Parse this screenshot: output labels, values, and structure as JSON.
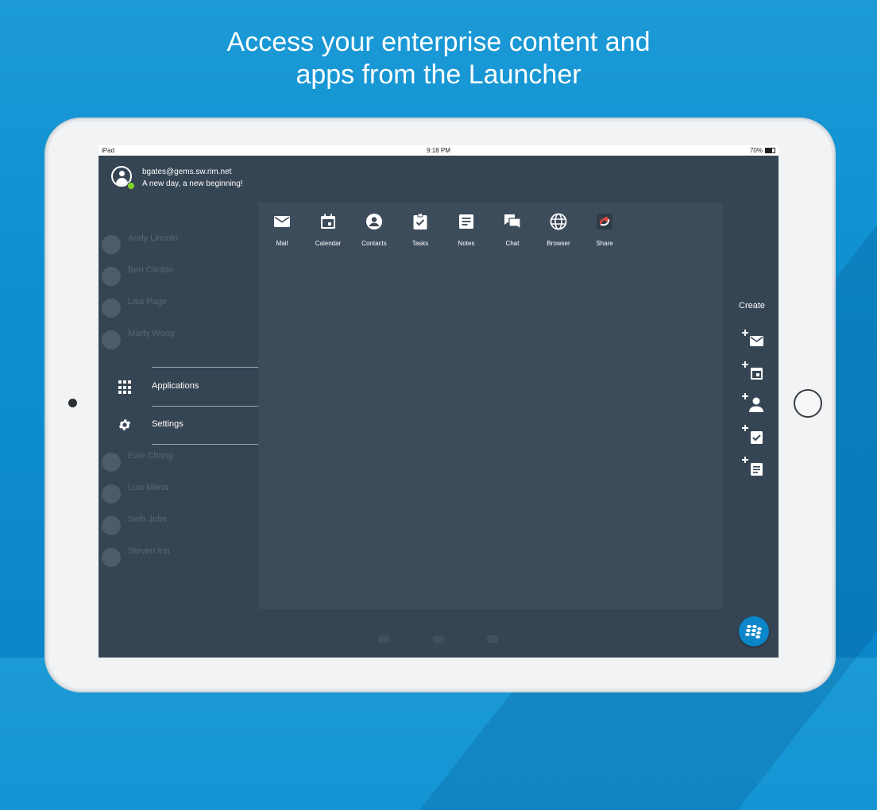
{
  "headline": [
    "Access your enterprise content and",
    "apps from the Launcher"
  ],
  "status_bar": {
    "device": "iPad",
    "time": "9:18 PM",
    "battery": "70%",
    "battery_fill": 0.7
  },
  "profile": {
    "email": "bgates@gems.sw.rim.net",
    "tagline": "A new day, a new beginning!",
    "presence_color": "#7ed321"
  },
  "nav": [
    {
      "label": "Applications",
      "icon": "grid-icon"
    },
    {
      "label": "Settings",
      "icon": "gear-icon"
    }
  ],
  "apps": [
    {
      "label": "Mail",
      "icon": "mail-icon"
    },
    {
      "label": "Calendar",
      "icon": "calendar-icon"
    },
    {
      "label": "Contacts",
      "icon": "contacts-icon"
    },
    {
      "label": "Tasks",
      "icon": "tasks-icon"
    },
    {
      "label": "Notes",
      "icon": "notes-icon"
    },
    {
      "label": "Chat",
      "icon": "chat-icon"
    },
    {
      "label": "Browser",
      "icon": "globe-icon"
    },
    {
      "label": "Share",
      "icon": "share-icon"
    }
  ],
  "create": {
    "title": "Create",
    "actions": [
      {
        "icon": "new-mail-icon"
      },
      {
        "icon": "new-event-icon"
      },
      {
        "icon": "new-contact-icon"
      },
      {
        "icon": "new-task-icon"
      },
      {
        "icon": "new-note-icon"
      }
    ]
  },
  "background_contacts": [
    "Andy Lincoln",
    "Ben Clinton",
    "Lisa Page",
    "Marty Wong",
    "Evie Chang",
    "Luis Mena",
    "Seth Jobs",
    "Steven Inn"
  ],
  "colors": {
    "accent": "#0a86c9",
    "screen_bg": "#364554",
    "panel_bg": "#3d4c5b"
  }
}
